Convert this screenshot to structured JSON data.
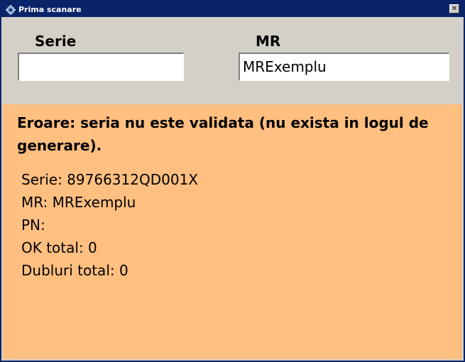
{
  "window": {
    "title": "Prima scanare",
    "close_glyph": "✕"
  },
  "form": {
    "serie_label": "Serie",
    "serie_value": "",
    "mr_label": "MR",
    "mr_value": "MRExemplu"
  },
  "status": {
    "background_color": "#ffbf80",
    "error_message": "Eroare: seria nu este validata (nu exista in logul de generare).",
    "lines": [
      "Serie: 89766312QD001X",
      "MR: MRExemplu",
      "PN:",
      "OK total: 0",
      "Dubluri total: 0"
    ]
  },
  "icons": {
    "app_icon": "gear-icon",
    "close_icon": "close-icon"
  }
}
